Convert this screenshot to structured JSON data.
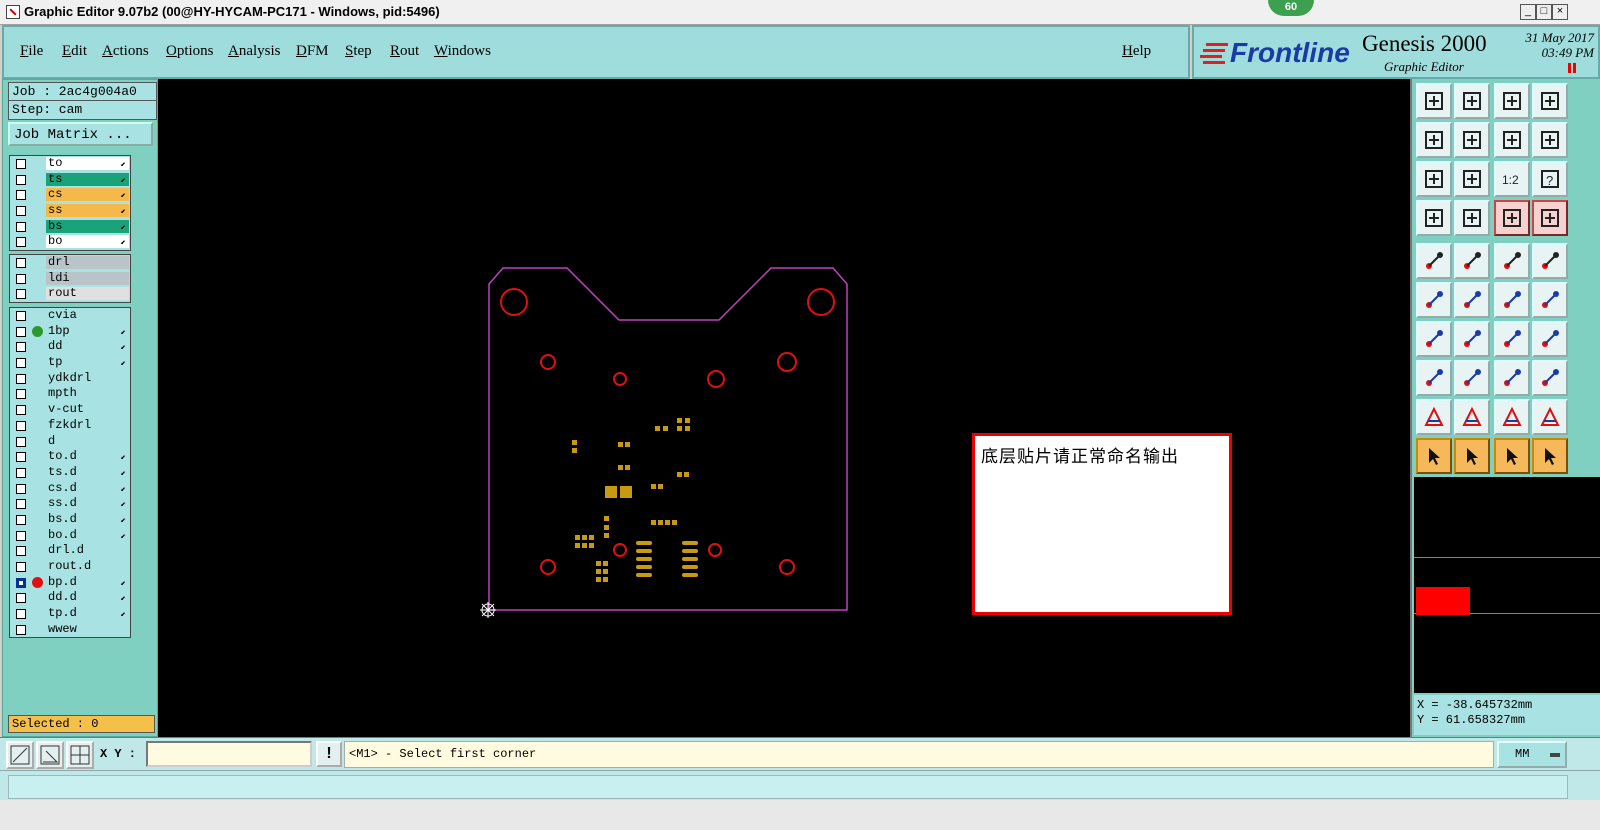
{
  "window": {
    "title": "Graphic Editor 9.07b2 (00@HY-HYCAM-PC171 - Windows, pid:5496)",
    "badge": "60",
    "controls": [
      "_",
      "□",
      "×"
    ]
  },
  "menu": {
    "items": [
      "File",
      "Edit",
      "Actions",
      "Options",
      "Analysis",
      "DFM",
      "Step",
      "Rout",
      "Windows"
    ],
    "help": "Help"
  },
  "brand": {
    "logo": "Frontline",
    "product": "Genesis 2000",
    "subtitle": "Graphic Editor",
    "date": "31 May 2017",
    "time": "03:49 PM"
  },
  "job": {
    "job_line": "Job : 2ac4g004a0",
    "step_line": "Step: cam",
    "matrix_button": "Job Matrix ..."
  },
  "layer_groups": [
    [
      {
        "name": "to",
        "color": "#ffffff",
        "arrow": true
      },
      {
        "name": "ts",
        "color": "#1aa37a",
        "arrow": true
      },
      {
        "name": "cs",
        "color": "#f5b84a",
        "arrow": true
      },
      {
        "name": "ss",
        "color": "#f5b84a",
        "arrow": true
      },
      {
        "name": "bs",
        "color": "#1aa37a",
        "arrow": true
      },
      {
        "name": "bo",
        "color": "#ffffff",
        "arrow": true
      }
    ],
    [
      {
        "name": "drl",
        "color": "#b8c4c8",
        "arrow": false
      },
      {
        "name": "ldi",
        "color": "#b8c4c8",
        "arrow": false
      },
      {
        "name": "rout",
        "color": "#e0e0e0",
        "arrow": false
      }
    ],
    [
      {
        "name": "cvia",
        "color": "#a8e2e2",
        "arrow": false
      },
      {
        "name": "1bp",
        "color": "#a8e2e2",
        "arrow": true,
        "dot": "#2a9a2a"
      },
      {
        "name": "dd",
        "color": "#a8e2e2",
        "arrow": true
      },
      {
        "name": "tp",
        "color": "#a8e2e2",
        "arrow": true
      },
      {
        "name": "ydkdrl",
        "color": "#a8e2e2",
        "arrow": false
      },
      {
        "name": "mpth",
        "color": "#a8e2e2",
        "arrow": false
      },
      {
        "name": "v-cut",
        "color": "#a8e2e2",
        "arrow": false
      },
      {
        "name": "fzkdrl",
        "color": "#a8e2e2",
        "arrow": false
      },
      {
        "name": "d",
        "color": "#a8e2e2",
        "arrow": false
      },
      {
        "name": "to.d",
        "color": "#a8e2e2",
        "arrow": true
      },
      {
        "name": "ts.d",
        "color": "#a8e2e2",
        "arrow": true
      },
      {
        "name": "cs.d",
        "color": "#a8e2e2",
        "arrow": true
      },
      {
        "name": "ss.d",
        "color": "#a8e2e2",
        "arrow": true
      },
      {
        "name": "bs.d",
        "color": "#a8e2e2",
        "arrow": true
      },
      {
        "name": "bo.d",
        "color": "#a8e2e2",
        "arrow": true
      },
      {
        "name": "drl.d",
        "color": "#a8e2e2",
        "arrow": false
      },
      {
        "name": "rout.d",
        "color": "#a8e2e2",
        "arrow": false
      },
      {
        "name": "bp.d",
        "color": "#a8e2e2",
        "arrow": true,
        "dot": "#e01010",
        "selected": true
      },
      {
        "name": "dd.d",
        "color": "#a8e2e2",
        "arrow": true
      },
      {
        "name": "tp.d",
        "color": "#a8e2e2",
        "arrow": true
      },
      {
        "name": "wwew",
        "color": "#a8e2e2",
        "arrow": false
      }
    ]
  ],
  "selection": {
    "label": "Selected : 0"
  },
  "message_box": {
    "text": "底层贴片请正常命名输出"
  },
  "coordinates": {
    "x": "X = -38.645732mm",
    "y": "Y = 61.658327mm"
  },
  "command": {
    "xy_label": "X Y :",
    "xy_value": "",
    "prompt": "<M1> - Select first corner",
    "units": "MM"
  },
  "colors": {
    "profile": "#c040c0",
    "drill": "#e01010",
    "pad": "#c89a10",
    "canvas": "#000000"
  },
  "tool_icons": [
    "zoom-home-icon",
    "zoom-out-icon",
    "home-icon",
    "window-icon",
    "pan-left-icon",
    "pan-right-icon",
    "undo-view-icon",
    "redraw-icon",
    "fit-icon",
    "zoom-fit-icon",
    "scale-1-2-icon",
    "help-icon",
    "measure-icon",
    "snap-icon",
    "net-icon",
    "net-alt-icon",
    "fill-icon",
    "outline-icon",
    "ruler-icon",
    "circle-icon",
    "connect-icon",
    "cross-icon",
    "point-icon",
    "point-alt-icon",
    "line-icon",
    "line-alt-icon",
    "arc-icon",
    "mirror-icon",
    "pad-icon",
    "segment-icon",
    "move-icon",
    "group-icon",
    "triangle-icon",
    "triangle-alt-icon",
    "text-icon",
    "text-alt-icon",
    "select-icon",
    "select-box-icon",
    "select-alt-icon",
    "select-net-icon"
  ]
}
